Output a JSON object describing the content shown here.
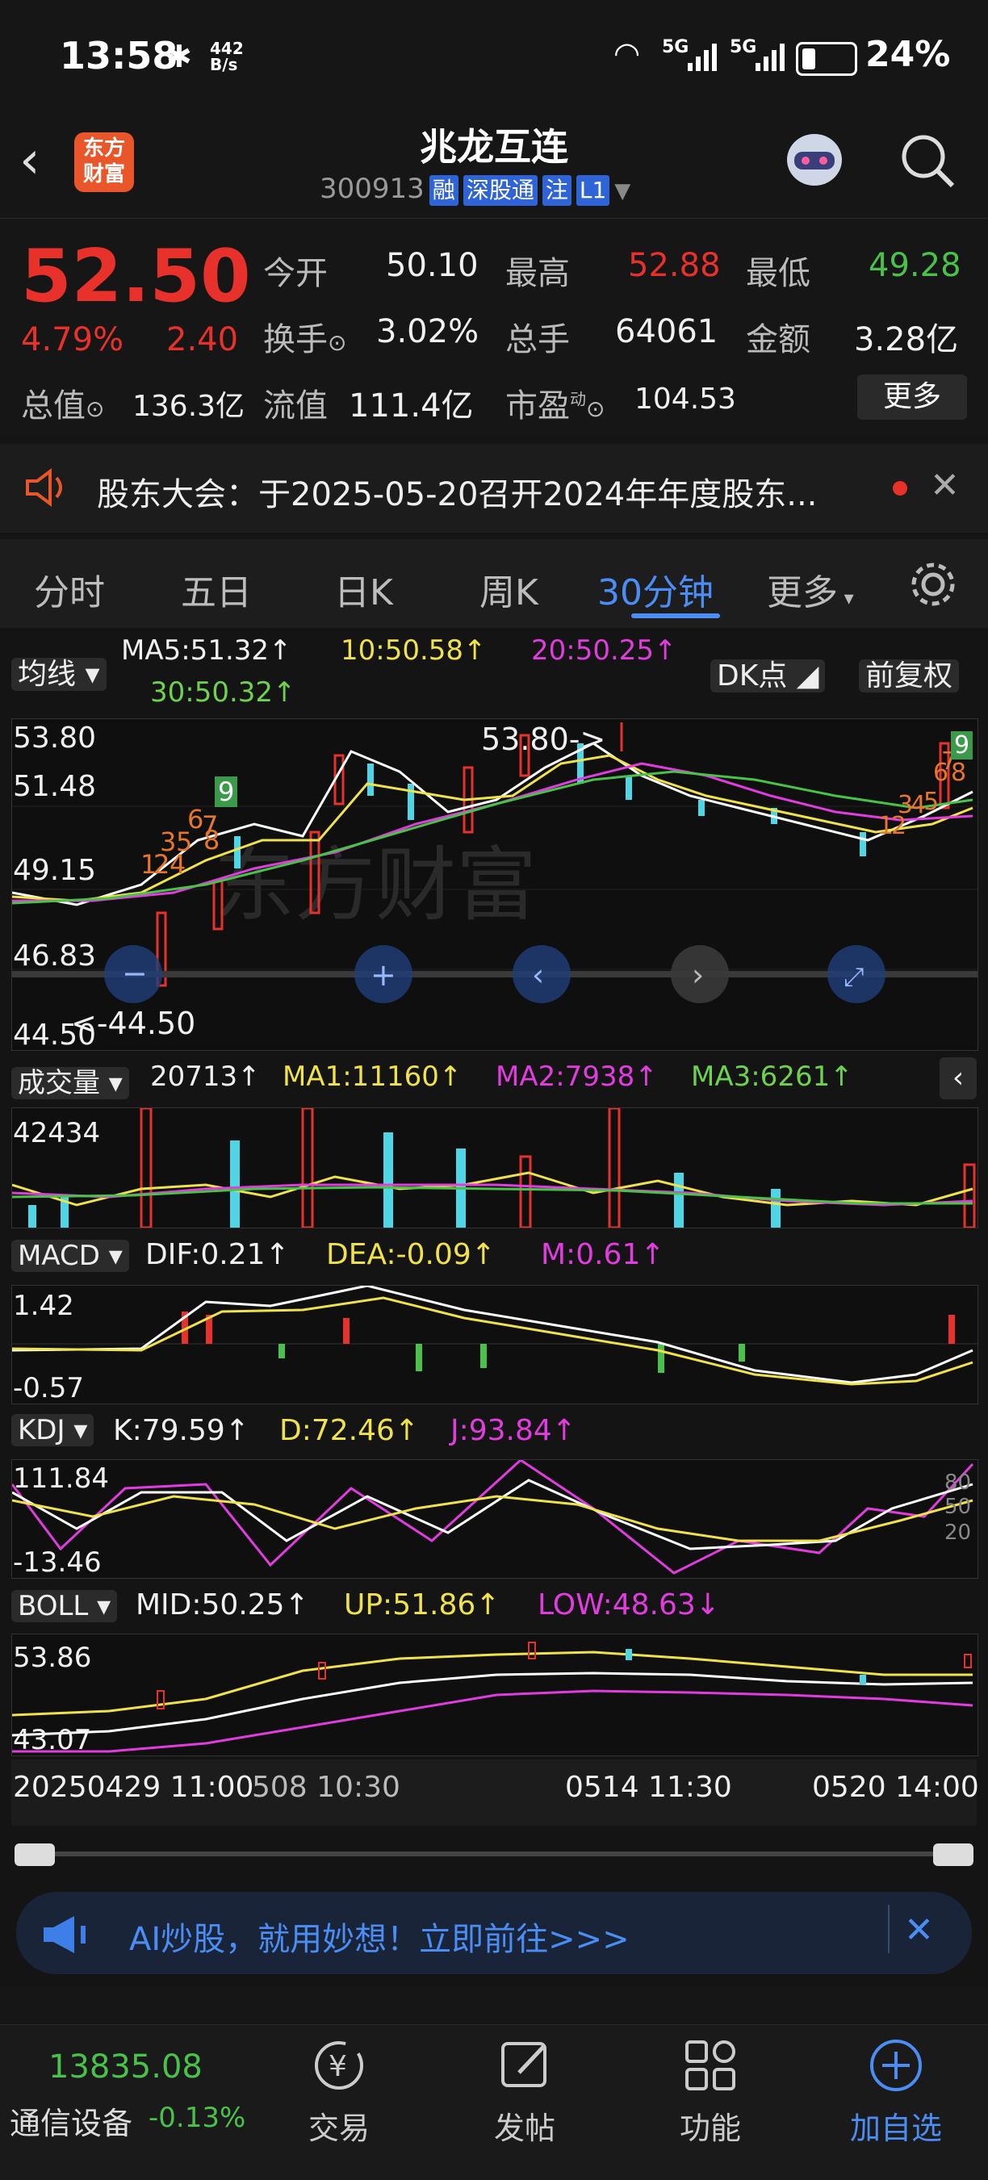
{
  "status": {
    "time": "13:58",
    "speed_top": "442",
    "speed_unit": "B/s",
    "battery": "24%",
    "net1": "5G",
    "net2": "5G"
  },
  "header": {
    "title": "兆龙互连",
    "code": "300913",
    "tags": [
      "融",
      "深股通",
      "注",
      "L1"
    ],
    "logo_line1": "东方",
    "logo_line2": "财富"
  },
  "quote": {
    "price": "52.50",
    "pct": "4.79%",
    "chg": "2.40",
    "open_label": "今开",
    "open": "50.10",
    "high_label": "最高",
    "high": "52.88",
    "low_label": "最低",
    "low": "49.28",
    "turnover_label": "换手",
    "turnover": "3.02%",
    "vol_label": "总手",
    "vol": "64061",
    "amount_label": "金额",
    "amount": "3.28亿",
    "mcap_label": "总值",
    "mcap": "136.3亿",
    "float_label": "流值",
    "float": "111.4亿",
    "pe_label": "市盈",
    "pe_sup": "动",
    "pe": "104.53",
    "more": "更多"
  },
  "notice": {
    "text": "股东大会：于2025-05-20召开2024年年度股东..."
  },
  "tabs": [
    "分时",
    "五日",
    "日K",
    "周K",
    "30分钟",
    "更多"
  ],
  "ma": {
    "selector": "均线",
    "ma5": "MA5:51.32↑",
    "ma10": "10:50.58↑",
    "ma20": "20:50.25↑",
    "ma30": "30:50.32↑",
    "dk": "DK点",
    "adj": "前复权"
  },
  "kline": {
    "y1": "53.80",
    "y2": "51.48",
    "y3": "49.15",
    "y4": "46.83",
    "y5": "44.50",
    "hi_note": "53.80->",
    "lo_note": "<-44.50",
    "marks": [
      "1",
      "2",
      "4",
      "3",
      "5",
      "6",
      "7",
      "8",
      "9",
      "1",
      "2",
      "3",
      "4",
      "5",
      "6",
      "7",
      "8",
      "9"
    ]
  },
  "vol": {
    "selector": "成交量",
    "val": "20713↑",
    "ma1": "MA1:11160↑",
    "ma2": "MA2:7938↑",
    "ma3": "MA3:6261↑",
    "ytop": "42434"
  },
  "macd": {
    "selector": "MACD",
    "dif": "DIF:0.21↑",
    "dea": "DEA:-0.09↑",
    "m": "M:0.61↑",
    "ytop": "1.42",
    "ybot": "-0.57"
  },
  "kdj": {
    "selector": "KDJ",
    "k": "K:79.59↑",
    "d": "D:72.46↑",
    "j": "J:93.84↑",
    "ytop": "111.84",
    "ybot": "-13.46",
    "r80": "80",
    "r50": "50",
    "r20": "20"
  },
  "boll": {
    "selector": "BOLL",
    "mid": "MID:50.25↑",
    "up": "UP:51.86↑",
    "low": "LOW:48.63↓",
    "ytop": "53.86",
    "ybot": "43.07"
  },
  "xaxis": {
    "t1": "20250429 11:00",
    "t2": "508 10:30",
    "t3": "0514 11:30",
    "t4": "0520 14:00"
  },
  "ai": {
    "text": "AI炒股，就用妙想！立即前往>>>"
  },
  "bottom": {
    "index_val": "13835.08",
    "index_name": "通信设备",
    "index_pct": "-0.13%",
    "trade": "交易",
    "post": "发帖",
    "func": "功能",
    "watch": "加自选"
  },
  "colors": {
    "up": "#e8312a",
    "down": "#4fd6e6",
    "ma5": "#ffffff",
    "ma10": "#f0e24a",
    "ma20": "#e23ce0",
    "ma30": "#49c24a",
    "accent": "#4a8ef5"
  }
}
